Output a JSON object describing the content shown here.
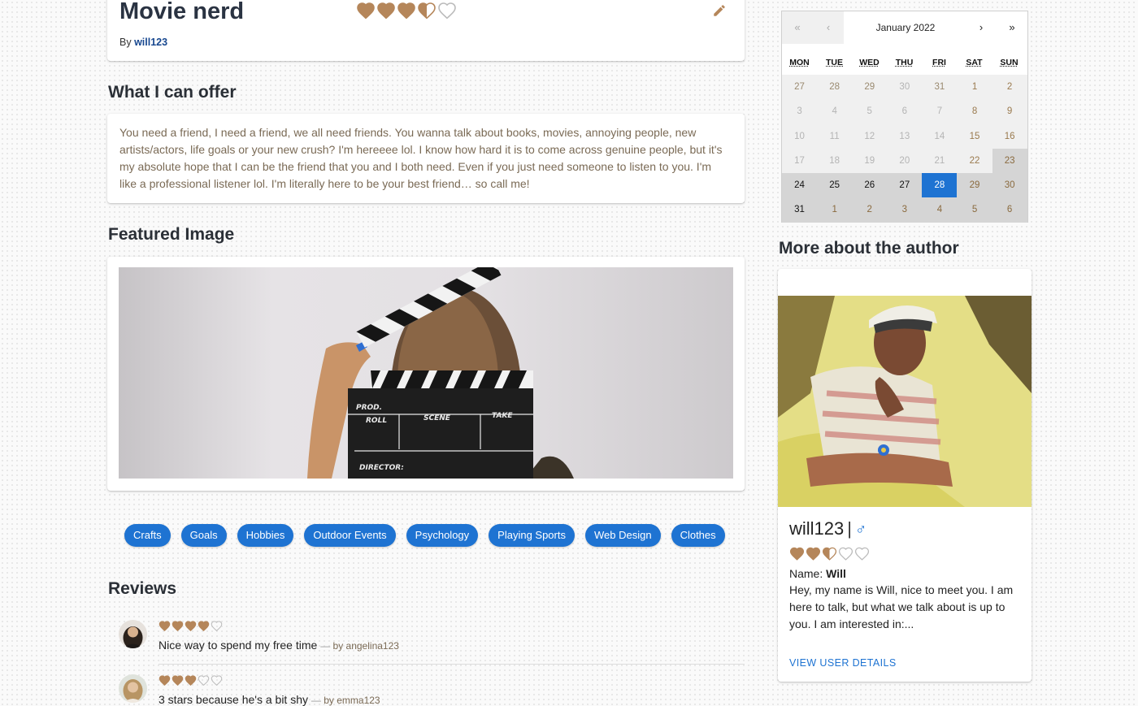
{
  "post": {
    "title": "Movie nerd",
    "rating": 3.5,
    "by_label": "By",
    "author": "will123"
  },
  "offer": {
    "heading": "What I can offer",
    "text": "You need a friend, I need a friend, we all need friends. You wanna talk about books, movies, annoying people, new artists/actors, life goals or your new crush? I'm hereeee lol. I know how hard it is to come across genuine people, but it's my absolute hope that I can be the friend that you and I both need. Even if you just need someone to listen to you. I'm like a professional listener lol. I'm literally here to be your best friend… so call me!"
  },
  "featured": {
    "heading": "Featured Image",
    "slate": {
      "prod": "PROD.",
      "roll": "ROLL",
      "scene": "SCENE",
      "take": "TAKE",
      "director": "DIRECTOR:"
    }
  },
  "tags": [
    "Crafts",
    "Goals",
    "Hobbies",
    "Outdoor Events",
    "Psychology",
    "Playing Sports",
    "Web Design",
    "Clothes"
  ],
  "reviews": {
    "heading": "Reviews",
    "items": [
      {
        "rating": 4,
        "text": "Nice way to spend my free time",
        "by": "by angelina123"
      },
      {
        "rating": 3,
        "text": "3 stars because he's a bit shy",
        "by": "by emma123"
      }
    ]
  },
  "calendar": {
    "month_label": "January 2022",
    "nav": {
      "prev_year": "«",
      "prev_month": "‹",
      "next_month": "›",
      "next_year": "»"
    },
    "weekdays": [
      "MON",
      "TUE",
      "WED",
      "THU",
      "FRI",
      "SAT",
      "SUN"
    ],
    "days": [
      {
        "n": "27",
        "s": "dis-neighbor"
      },
      {
        "n": "28",
        "s": "dis-neighbor"
      },
      {
        "n": "29",
        "s": "dis-neighbor"
      },
      {
        "n": "30",
        "s": "disabled"
      },
      {
        "n": "31",
        "s": "dis-neighbor"
      },
      {
        "n": "1",
        "s": "dis-weekend"
      },
      {
        "n": "2",
        "s": "dis-weekend"
      },
      {
        "n": "3",
        "s": "disabled"
      },
      {
        "n": "4",
        "s": "disabled"
      },
      {
        "n": "5",
        "s": "disabled"
      },
      {
        "n": "6",
        "s": "disabled"
      },
      {
        "n": "7",
        "s": "disabled"
      },
      {
        "n": "8",
        "s": "dis-weekend"
      },
      {
        "n": "9",
        "s": "dis-weekend"
      },
      {
        "n": "10",
        "s": "disabled"
      },
      {
        "n": "11",
        "s": "disabled"
      },
      {
        "n": "12",
        "s": "disabled"
      },
      {
        "n": "13",
        "s": "disabled"
      },
      {
        "n": "14",
        "s": "disabled"
      },
      {
        "n": "15",
        "s": "dis-weekend"
      },
      {
        "n": "16",
        "s": "dis-weekend"
      },
      {
        "n": "17",
        "s": "disabled"
      },
      {
        "n": "18",
        "s": "disabled"
      },
      {
        "n": "19",
        "s": "disabled"
      },
      {
        "n": "20",
        "s": "disabled"
      },
      {
        "n": "21",
        "s": "disabled"
      },
      {
        "n": "22",
        "s": "dis-weekend"
      },
      {
        "n": "23",
        "s": "avail-weekend"
      },
      {
        "n": "24",
        "s": "avail"
      },
      {
        "n": "25",
        "s": "avail"
      },
      {
        "n": "26",
        "s": "avail"
      },
      {
        "n": "27",
        "s": "avail"
      },
      {
        "n": "28",
        "s": "active"
      },
      {
        "n": "29",
        "s": "avail-weekend"
      },
      {
        "n": "30",
        "s": "avail-weekend"
      },
      {
        "n": "31",
        "s": "avail"
      },
      {
        "n": "1",
        "s": "neighbor"
      },
      {
        "n": "2",
        "s": "neighbor"
      },
      {
        "n": "3",
        "s": "neighbor"
      },
      {
        "n": "4",
        "s": "neighbor"
      },
      {
        "n": "5",
        "s": "neighbor"
      },
      {
        "n": "6",
        "s": "neighbor"
      }
    ]
  },
  "author": {
    "heading": "More about the author",
    "username": "will123",
    "separator": "|",
    "gender_symbol": "♂",
    "rating": 2.5,
    "name_label": "Name:",
    "name": "Will",
    "bio": "Hey, my name is Will, nice to meet you. I am here to talk, but what we talk about is up to you. I am interested in:...",
    "details_link": "VIEW USER DETAILS"
  },
  "colors": {
    "accent": "#1e73d2",
    "heart": "#b5865a",
    "heading": "#2a2f36"
  }
}
